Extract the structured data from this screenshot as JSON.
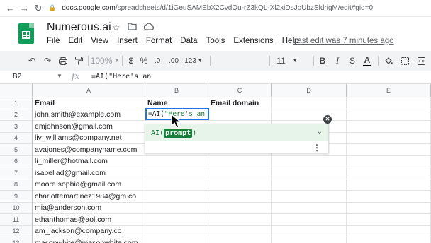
{
  "browser": {
    "url_host": "docs.google.com",
    "url_path": "/spreadsheets/d/1iGeuSAMEbX2CvdQu-rZ3kQL-Xl2xiDsJoUbzSldrigM/edit#gid=0"
  },
  "doc": {
    "title": "Numerous.ai",
    "menu": [
      "File",
      "Edit",
      "View",
      "Insert",
      "Format",
      "Data",
      "Tools",
      "Extensions",
      "Help"
    ],
    "last_edit": "Last edit was 7 minutes ago"
  },
  "toolbar": {
    "zoom": "100%",
    "currency": "$",
    "percent": "%",
    "dec_decrease": ".0",
    "dec_increase": ".00",
    "more_formats": "123",
    "font_size": "11",
    "bold": "B",
    "italic": "I",
    "strikethrough": "S",
    "text_color": "A"
  },
  "formula_bar": {
    "cell_ref": "B2",
    "fx": "fx",
    "formula": "=AI(\"Here's an"
  },
  "grid": {
    "columns": [
      "A",
      "B",
      "C",
      "D",
      "E"
    ],
    "rows": [
      "1",
      "2",
      "3",
      "4",
      "5",
      "6",
      "7",
      "8",
      "9",
      "10",
      "11",
      "12",
      "13"
    ],
    "col_a": [
      "Email",
      "john.smith@example.com",
      "emjohnson@gmail.com",
      "liv_williams@company.net",
      "avajones@companyname.com",
      "li_miller@hotmail.com",
      "isabellad@gmail.com",
      "moore.sophia@gmail.com",
      "charlottemartinez1984@gm.co",
      "mia@anderson.com",
      "ethanthomas@aol.com",
      "am_jackson@company.co",
      "masonwhite@masonwhite.com"
    ],
    "col_b_header": "Name",
    "col_c_header": "Email domain"
  },
  "editor": {
    "prefix": "=AI(",
    "string": "\"Here's an e"
  },
  "autocomplete": {
    "fn": "AI(",
    "arg": "prompt",
    "close": ")"
  },
  "colors": {
    "selection": "#1a73e8",
    "popup_bg": "#e6f4ea",
    "arg_bg": "#188038",
    "sheets_green": "#0f9d58"
  }
}
